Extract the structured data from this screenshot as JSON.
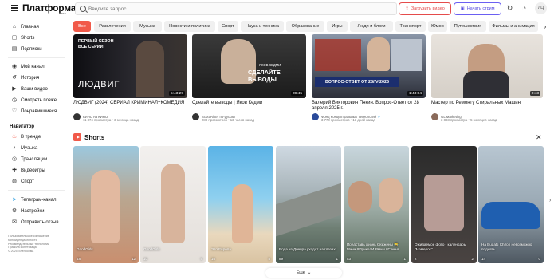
{
  "header": {
    "logo": "Платформа",
    "logo_beta": "Бета",
    "search_placeholder": "Введите запрос",
    "upload_label": "Загрузить видео",
    "stream_label": "Начать стрим",
    "avatar_initials": "ЛЦ",
    "icons": [
      "menu-icon",
      "search-icon",
      "upload-icon",
      "camera-icon",
      "refresh-icon",
      "bell-icon"
    ]
  },
  "sidebar": {
    "main": [
      {
        "label": "Главная",
        "icon": "home-icon"
      },
      {
        "label": "Shorts",
        "icon": "shorts-icon"
      },
      {
        "label": "Подписки",
        "icon": "subscriptions-icon"
      }
    ],
    "library": [
      {
        "label": "Мой канал",
        "icon": "channel-icon"
      },
      {
        "label": "История",
        "icon": "history-icon"
      },
      {
        "label": "Ваши видео",
        "icon": "videos-icon"
      },
      {
        "label": "Смотреть позже",
        "icon": "clock-icon"
      },
      {
        "label": "Понравившиеся",
        "icon": "like-icon"
      }
    ],
    "navigator_heading": "Навигатор",
    "navigator": [
      {
        "label": "В тренде",
        "icon": "fire-icon"
      },
      {
        "label": "Музыка",
        "icon": "music-icon"
      },
      {
        "label": "Трансляции",
        "icon": "broadcast-icon"
      },
      {
        "label": "Видеоигры",
        "icon": "gamepad-icon"
      },
      {
        "label": "Спорт",
        "icon": "sport-icon"
      }
    ],
    "extra": [
      {
        "label": "Телеграм-канал",
        "icon": "telegram-icon"
      },
      {
        "label": "Настройки",
        "icon": "gear-icon"
      },
      {
        "label": "Отправить отзыв",
        "icon": "feedback-icon"
      }
    ],
    "footer": [
      "Пользовательское соглашение",
      "Конфиденциальность",
      "Рекомендательные технологии",
      "Правила монетизации",
      "© 2025 Платформа"
    ]
  },
  "chips": [
    "Все",
    "Развлечения",
    "Музыка",
    "Новости и политика",
    "Спорт",
    "Наука и техника",
    "Образование",
    "Игры",
    "Люди и блоги",
    "Транспорт",
    "Юмор",
    "Путешествия",
    "Фильмы и анимация"
  ],
  "videos": [
    {
      "title": "ЛЮДВИГ (2024) СЕРИАЛ КРИМИНАЛ+КОМЕДИЯ",
      "channel": "КИНО на КИНО",
      "meta": "11 874 просмотра • 3 месяца назад",
      "duration": "5:43:29",
      "overlay_top": "ПЕРВЫЙ СЕЗОН ВСЕ СЕРИИ",
      "overlay_big": "ЛЮДВИГ"
    },
    {
      "title": "Сделайте выводы | Яков Кедми",
      "channel": "Scott Ritter по-русски",
      "meta": "288 просмотров • 13 часов назад",
      "duration": "39:45",
      "overlay_top": "ЯКОВ КЕДМИ",
      "overlay_big": "СДЕЛАЙТЕ ВЫВОДЫ"
    },
    {
      "title": "Валерий Викторович Пякин. Вопрос-Ответ от 28 апреля 2025 г.",
      "channel": "Фонд Концептуальных Технологий",
      "meta": "3 770 просмотров • 13 дней назад",
      "duration": "1:43:04",
      "overlay_big": "ВОПРОС-ОТВЕТ ОТ 28/IV-2025"
    },
    {
      "title": "Мастер по Ремонту Стиральных Машин",
      "channel": "GL Marketing",
      "meta": "3 893 просмотра • 5 месяцев назад",
      "duration": "0:43"
    }
  ],
  "shorts_heading": "Shorts",
  "shorts": [
    {
      "caption": "GoodGirls",
      "comments": "48",
      "likes": "12"
    },
    {
      "caption": "GoodGirls",
      "comments": "10",
      "likes": "9"
    },
    {
      "caption": "Это Европа",
      "comments": "16",
      "likes": "5"
    },
    {
      "caption": "Вода из Днепра уходит на глазах!",
      "comments": "89",
      "likes": "1"
    },
    {
      "caption": "Представь жизнь без жены 😂 Мини #ПриколИ Ямим #Семья",
      "comments": "53",
      "likes": "1"
    },
    {
      "caption": "Ожидаемое фото - календарь \"Мэмерос\"",
      "comments": "2",
      "likes": "2"
    },
    {
      "caption": "Ha Bugatti Chiron невозможно поднять",
      "comments": "14",
      "likes": "0"
    }
  ],
  "more_label": "Еще"
}
